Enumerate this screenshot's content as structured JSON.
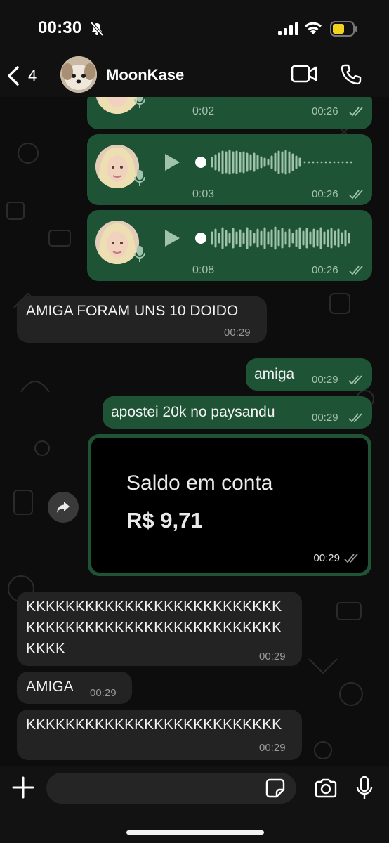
{
  "status_bar": {
    "time": "00:30"
  },
  "header": {
    "back_count": "4",
    "contact_name": "MoonKase"
  },
  "voice_messages": [
    {
      "duration": "0:02",
      "time": "00:26"
    },
    {
      "duration": "0:03",
      "time": "00:26"
    },
    {
      "duration": "0:08",
      "time": "00:26"
    }
  ],
  "messages": [
    {
      "text": "AMIGA FORAM UNS 10 DOIDO",
      "time": "00:29"
    },
    {
      "text": "amiga",
      "time": "00:29"
    },
    {
      "text": "apostei 20k no paysandu",
      "time": "00:29"
    },
    {
      "line1": "KKKKKKKKKKKKKKKKKKKKKKKKKK",
      "line2": "KKKKKKKKKKKKKKKKKKKKKKKKKK",
      "line3": "KKKK",
      "time": "00:29"
    },
    {
      "text": "AMIGA",
      "time": "00:29"
    },
    {
      "text": "KKKKKKKKKKKKKKKKKKKKKKKKKK",
      "time": "00:29"
    }
  ],
  "image_message": {
    "title": "Saldo em conta",
    "value": "R$ 9,71",
    "time": "00:29"
  },
  "input": {
    "placeholder": ""
  },
  "colors": {
    "outgoing": "#1f5335",
    "incoming": "#232323",
    "background": "#0d0d0d"
  },
  "icons": [
    "bell-off-icon",
    "signal-icon",
    "wifi-icon",
    "battery-icon",
    "back-chevron-icon",
    "video-call-icon",
    "phone-icon",
    "play-icon",
    "mic-icon",
    "double-check-icon",
    "forward-icon",
    "plus-icon",
    "sticker-icon",
    "camera-icon"
  ]
}
